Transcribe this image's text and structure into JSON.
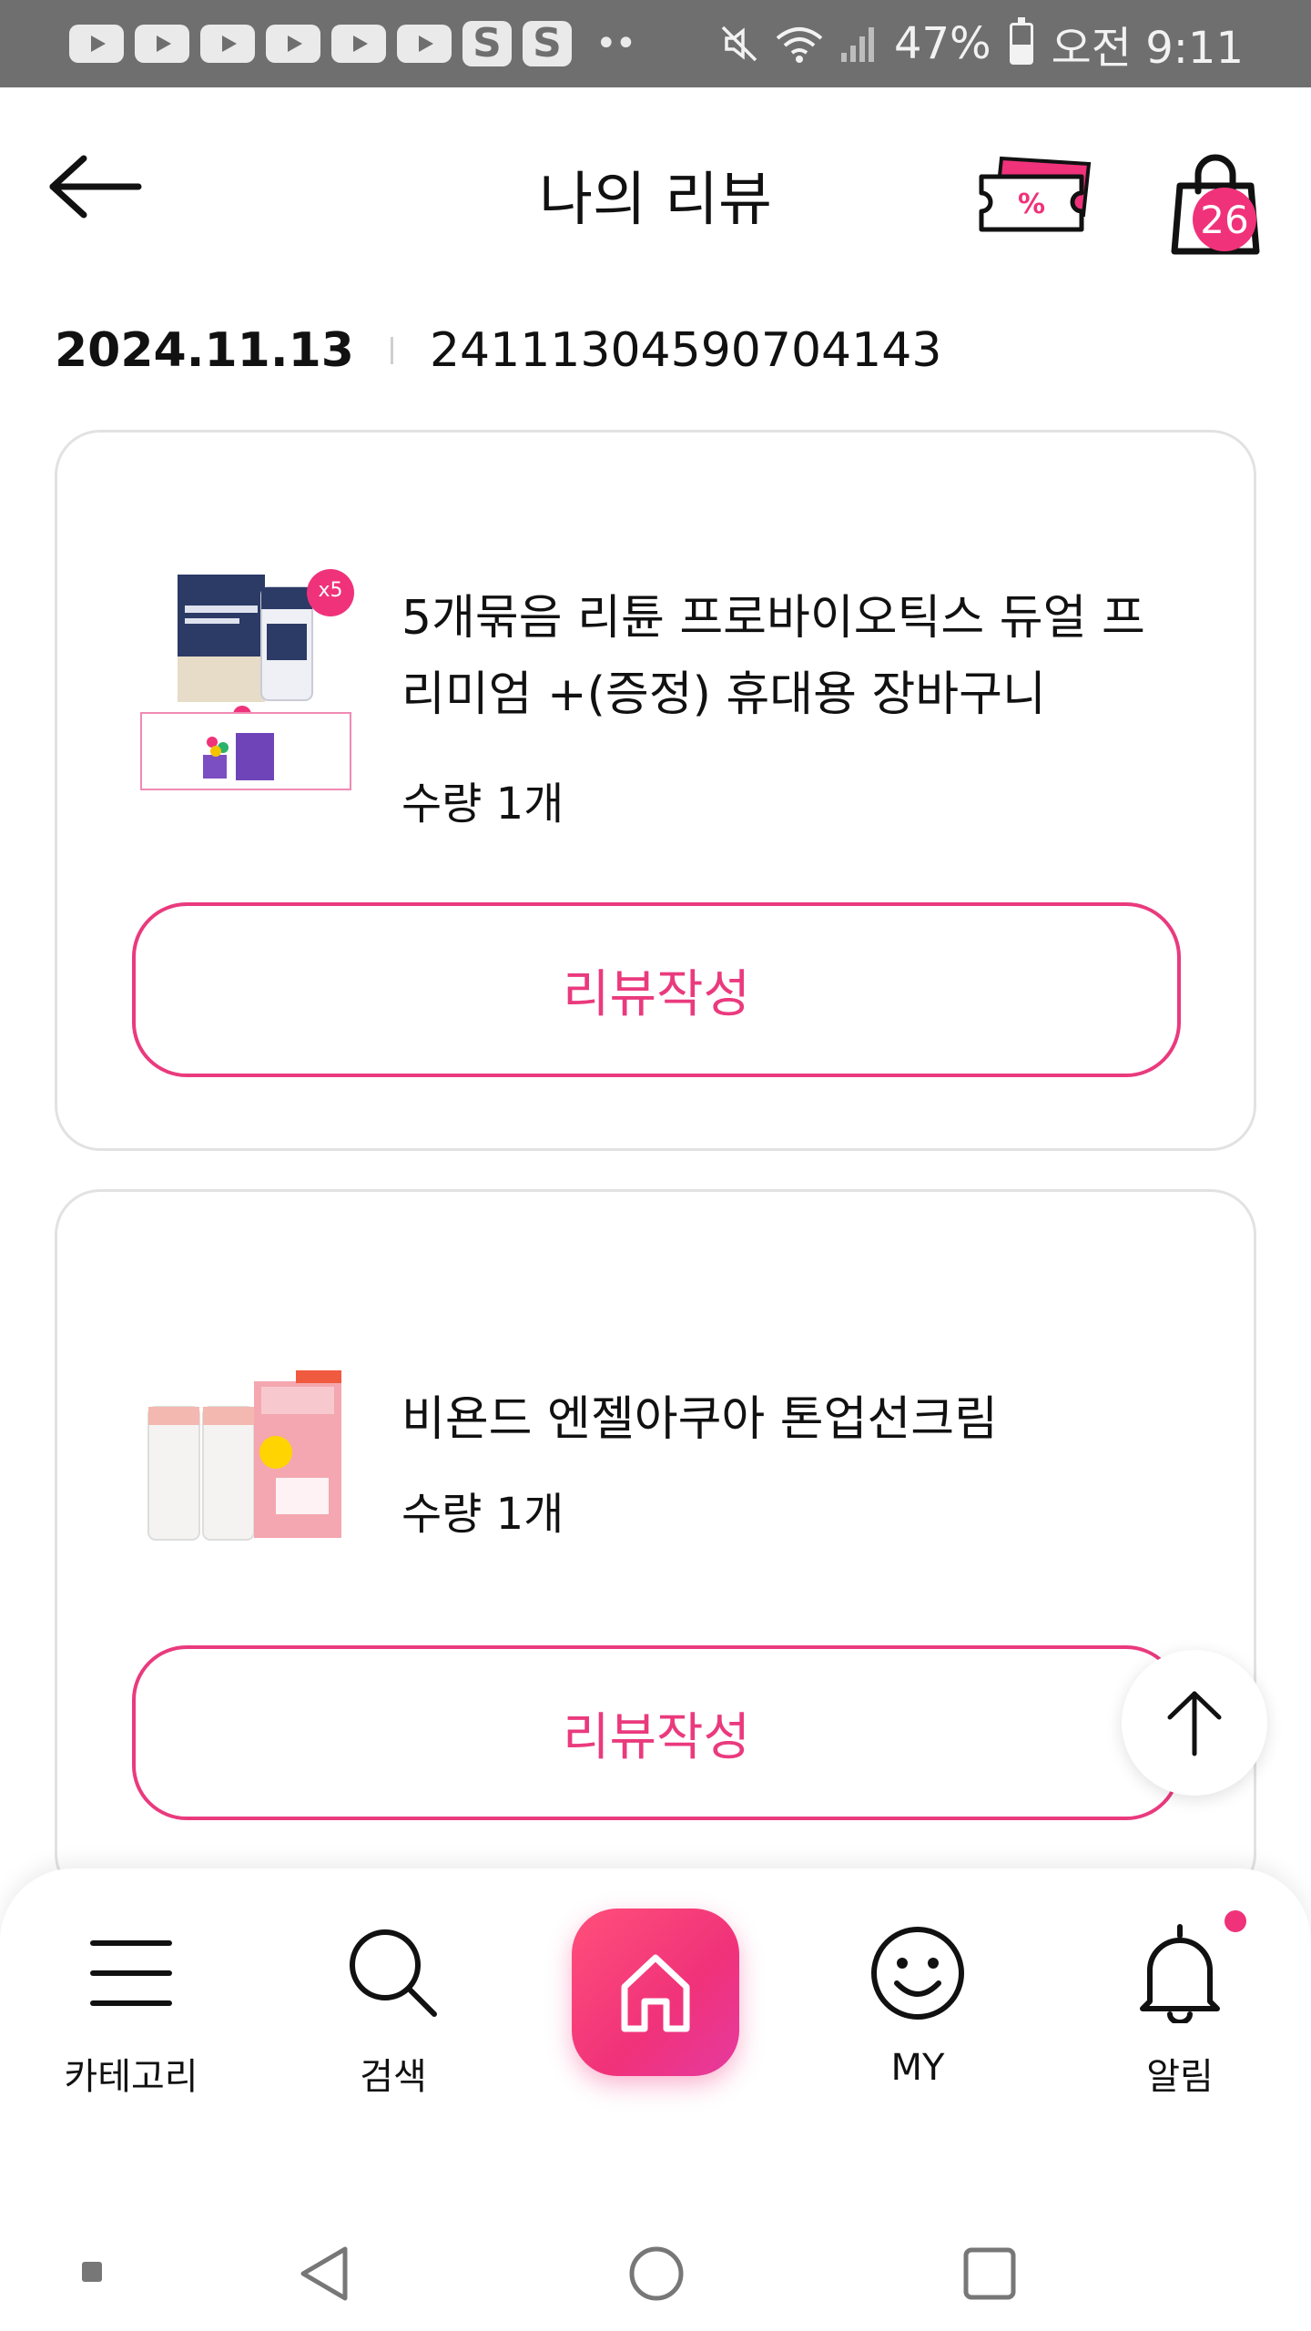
{
  "status_bar": {
    "notification_icons": [
      "youtube-icon",
      "youtube-icon",
      "youtube-icon",
      "youtube-icon",
      "youtube-icon",
      "youtube-icon",
      "s-app-icon",
      "s-app-icon"
    ],
    "s_letter": "S",
    "more": "••",
    "battery_percent": "47%",
    "battery_level": 0.47,
    "time": "오전 9:11"
  },
  "header": {
    "title": "나의 리뷰",
    "cart_count": "26"
  },
  "order": {
    "date": "2024.11.13",
    "number": "24111304590704143"
  },
  "reviews": [
    {
      "name": "5개묶음 리튠 프로바이오틱스 듀얼 프리미엄 +(증정) 휴대용 장바구니",
      "quantity": "수량 1개",
      "image_badge": "x5",
      "button": "리뷰작성"
    },
    {
      "name": "비욘드 엔젤아쿠아 톤업선크림",
      "quantity": "수량 1개",
      "button": "리뷰작성"
    }
  ],
  "bottom_nav": {
    "category": "카테고리",
    "search": "검색",
    "my": "MY",
    "alarm": "알림"
  },
  "colors": {
    "accent": "#f0327a",
    "status_bar": "#6f6f6f",
    "card_border": "#e2e2e2"
  }
}
